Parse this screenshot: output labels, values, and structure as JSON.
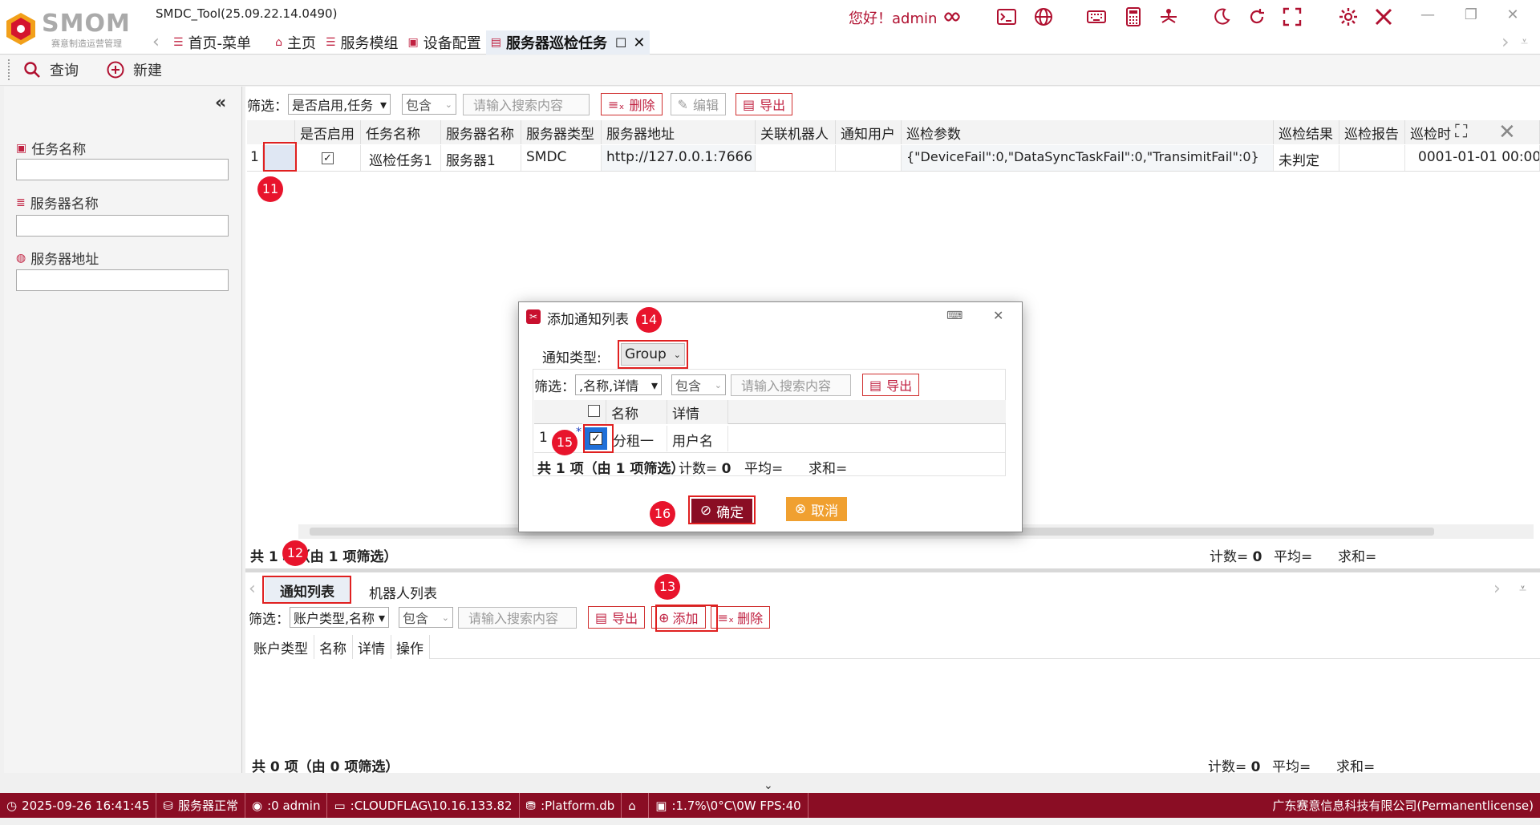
{
  "app": {
    "title": "SMDC_Tool(25.09.22.14.0490)",
    "logo_text": "SMOM",
    "logo_sub": "赛意制造运营管理",
    "greeting": "您好！admin",
    "accent": "#b01030"
  },
  "tabs": [
    {
      "label": "首页-菜单",
      "icon": "menu-icon"
    },
    {
      "label": "主页",
      "icon": "home-icon"
    },
    {
      "label": "服务模组",
      "icon": "list-icon"
    },
    {
      "label": "设备配置",
      "icon": "device-icon"
    },
    {
      "label": "服务器巡检任务",
      "icon": "task-icon",
      "active": true
    }
  ],
  "toolbar": {
    "query_label": "查询",
    "new_label": "新建"
  },
  "left_panel": {
    "fields": [
      {
        "label": "任务名称",
        "icon": "calendar-icon"
      },
      {
        "label": "服务器名称",
        "icon": "server-icon"
      },
      {
        "label": "服务器地址",
        "icon": "globe-icon"
      }
    ]
  },
  "top_grid": {
    "filter_label": "筛选：",
    "filter_field": "是否启用,任务",
    "filter_op": "包含",
    "search_placeholder": "请输入搜索内容",
    "delete_label": "删除",
    "edit_label": "编辑",
    "export_label": "导出",
    "columns": [
      "是否启用",
      "任务名称",
      "服务器名称",
      "服务器类型",
      "服务器地址",
      "关联机器人",
      "通知用户",
      "巡检参数",
      "巡检结果",
      "巡检报告",
      "巡检时"
    ],
    "rows": [
      {
        "index": "1",
        "enabled": true,
        "task_name": "巡检任务1",
        "server_name": "服务器1",
        "server_type": "SMDC",
        "server_address": "http://127.0.0.1:7666",
        "robot": "",
        "notify_user": "",
        "params": "{\"DeviceFail\":0,\"DataSyncTaskFail\":0,\"TransimitFail\":0}",
        "result": "未判定",
        "report": "",
        "time": "0001-01-01 00:00"
      }
    ],
    "summary": "共 1 项（由 1 项筛选）",
    "count_label": "计数=",
    "count_value": "0",
    "avg_label": "平均=",
    "sum_label": "求和="
  },
  "bottom_tabs": {
    "tabs": [
      "通知列表",
      "机器人列表"
    ],
    "filter_label": "筛选：",
    "filter_field": "账户类型,名称",
    "filter_op": "包含",
    "search_placeholder": "请输入搜索内容",
    "export_label": "导出",
    "add_label": "添加",
    "delete_label": "删除",
    "columns": [
      "账户类型",
      "名称",
      "详情",
      "操作"
    ],
    "summary": "共 0 项（由 0 项筛选）",
    "count_label": "计数=",
    "count_value": "0",
    "avg_label": "平均=",
    "sum_label": "求和="
  },
  "dialog": {
    "title": "添加通知列表",
    "type_label": "通知类型:",
    "type_value": "Group",
    "filter_label": "筛选：",
    "filter_field": ",名称,详情",
    "filter_op": "包含",
    "search_placeholder": "请输入搜索内容",
    "export_label": "导出",
    "columns": [
      "名称",
      "详情"
    ],
    "rows": [
      {
        "index": "1",
        "checked": true,
        "name": "分租一",
        "detail": "用户名"
      }
    ],
    "summary": "共 1 项（由 1 项筛选）",
    "count_label": "计数=",
    "count_value": "0",
    "avg_label": "平均=",
    "sum_label": "求和=",
    "ok_label": "确定",
    "cancel_label": "取消"
  },
  "badges": [
    "11",
    "12",
    "13",
    "14",
    "15",
    "16"
  ],
  "status_bar": {
    "datetime": "2025-09-26 16:41:45",
    "server_status": "服务器正常",
    "user": ":0 admin",
    "machine": ":CLOUDFLAG\\10.16.133.82",
    "db": ":Platform.db",
    "perf": ":1.7%\\0°C\\0W  FPS:40",
    "company": "广东赛意信息科技有限公司(Permanentlicense)"
  }
}
